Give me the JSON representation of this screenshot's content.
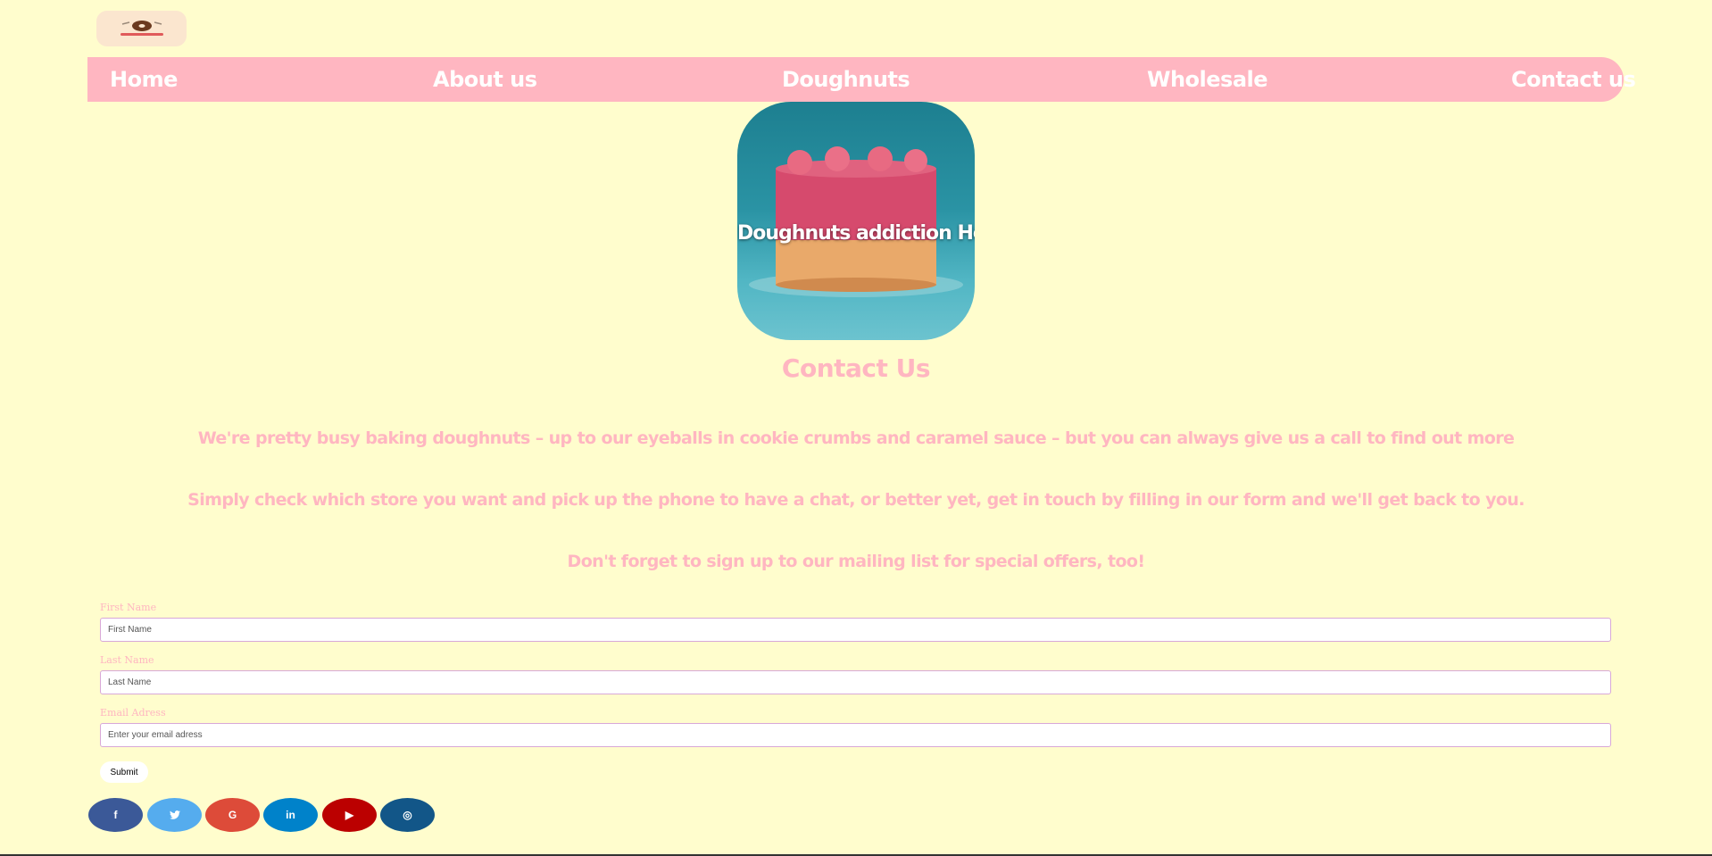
{
  "nav": {
    "items": [
      {
        "label": "Home"
      },
      {
        "label": "About us"
      },
      {
        "label": "Doughnuts"
      },
      {
        "label": "Wholesale"
      },
      {
        "label": "Contact us"
      }
    ]
  },
  "hero": {
    "title": "Doughnuts addiction Hotline"
  },
  "contact": {
    "title": "Contact Us",
    "paragraphs": [
      "We're pretty busy baking doughnuts – up to our eyeballs in cookie crumbs and caramel sauce – but you can always give us a call to find out more",
      "Simply check which store you want and pick up the phone to have a chat, or better yet, get in touch by filling in our form and we'll get back to you.",
      "Don't forget to sign up to our mailing list for special offers, too!"
    ]
  },
  "form": {
    "first_name": {
      "label": "First Name",
      "placeholder": "First Name"
    },
    "last_name": {
      "label": "Last Name",
      "placeholder": "Last Name"
    },
    "email": {
      "label": "Email Adress",
      "placeholder": "Enter your email adress"
    },
    "submit_label": "Submit"
  },
  "social": [
    {
      "icon": "facebook-icon",
      "glyph": "f",
      "color": "#3b5998"
    },
    {
      "icon": "twitter-icon",
      "glyph": "🐦",
      "color": "#55acee"
    },
    {
      "icon": "google-icon",
      "glyph": "G",
      "color": "#dd4b39"
    },
    {
      "icon": "linkedin-icon",
      "glyph": "in",
      "color": "#0082ca"
    },
    {
      "icon": "youtube-icon",
      "glyph": "▶",
      "color": "#bb0000"
    },
    {
      "icon": "instagram-icon",
      "glyph": "◎",
      "color": "#125688"
    }
  ]
}
